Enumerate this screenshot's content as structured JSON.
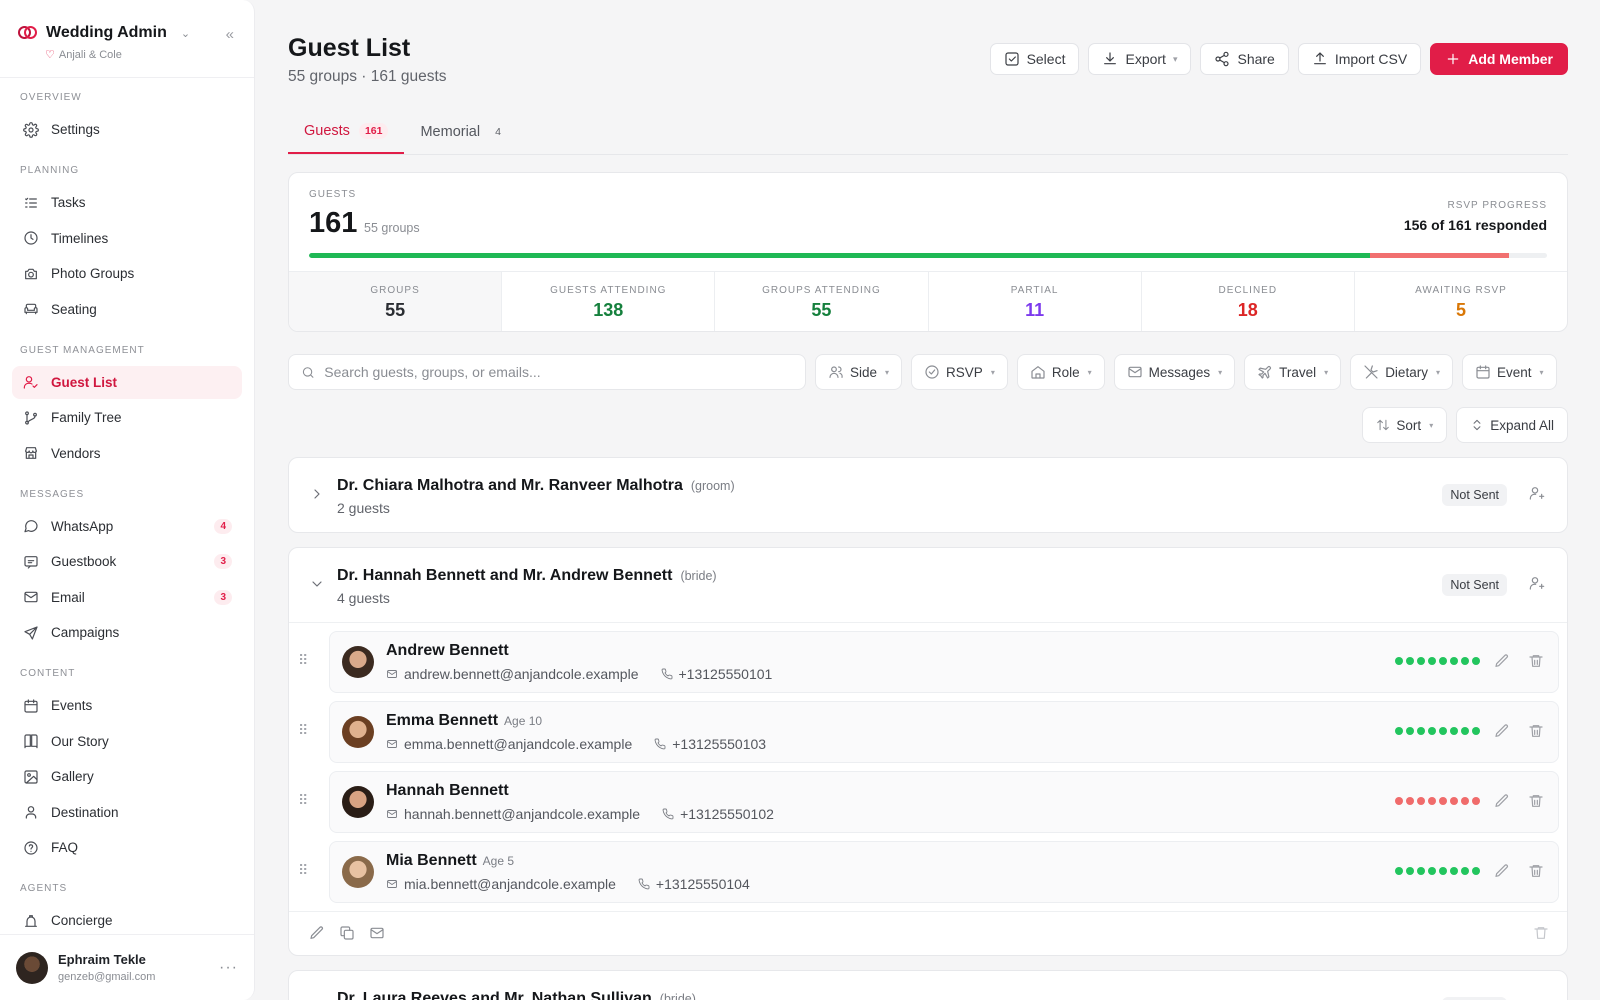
{
  "app": {
    "title": "Wedding Admin",
    "subtitle": "Anjali & Cole"
  },
  "sidebar": {
    "sections": [
      {
        "title": "OVERVIEW",
        "items": [
          {
            "label": "Settings",
            "icon": "gear-icon"
          }
        ]
      },
      {
        "title": "PLANNING",
        "items": [
          {
            "label": "Tasks",
            "icon": "list-icon"
          },
          {
            "label": "Timelines",
            "icon": "clock-icon"
          },
          {
            "label": "Photo Groups",
            "icon": "camera-icon"
          },
          {
            "label": "Seating",
            "icon": "sofa-icon"
          }
        ]
      },
      {
        "title": "GUEST MANAGEMENT",
        "items": [
          {
            "label": "Guest List",
            "icon": "user-check-icon",
            "active": true
          },
          {
            "label": "Family Tree",
            "icon": "branch-icon"
          },
          {
            "label": "Vendors",
            "icon": "store-icon"
          }
        ]
      },
      {
        "title": "MESSAGES",
        "items": [
          {
            "label": "WhatsApp",
            "icon": "chat-icon",
            "badge": "4"
          },
          {
            "label": "Guestbook",
            "icon": "message-square-icon",
            "badge": "3"
          },
          {
            "label": "Email",
            "icon": "mail-icon",
            "badge": "3"
          },
          {
            "label": "Campaigns",
            "icon": "send-icon"
          }
        ]
      },
      {
        "title": "CONTENT",
        "items": [
          {
            "label": "Events",
            "icon": "calendar-icon"
          },
          {
            "label": "Our Story",
            "icon": "book-icon"
          },
          {
            "label": "Gallery",
            "icon": "image-icon"
          },
          {
            "label": "Destination",
            "icon": "map-pin-icon"
          },
          {
            "label": "FAQ",
            "icon": "help-circle-icon"
          }
        ]
      },
      {
        "title": "AGENTS",
        "items": [
          {
            "label": "Concierge",
            "icon": "bell-icon"
          }
        ]
      }
    ]
  },
  "user": {
    "name": "Ephraim Tekle",
    "email": "genzeb@gmail.com"
  },
  "page": {
    "title": "Guest List",
    "subtitle": "55 groups · 161 guests"
  },
  "toolbar": {
    "select": "Select",
    "export": "Export",
    "share": "Share",
    "import": "Import CSV",
    "add": "Add Member"
  },
  "tabs": [
    {
      "label": "Guests",
      "count": "161",
      "active": true
    },
    {
      "label": "Memorial",
      "count": "4",
      "active": false
    }
  ],
  "summary": {
    "guests_caption": "GUESTS",
    "guests_total": "161",
    "groups_text": "55 groups",
    "rsvp_caption": "RSVP PROGRESS",
    "rsvp_text": "156 of 161 responded",
    "attending_fraction": 0.857,
    "declined_fraction": 0.112,
    "stats": [
      {
        "label": "GROUPS",
        "value": "55",
        "color": "#2b2e33",
        "selected": true
      },
      {
        "label": "GUESTS ATTENDING",
        "value": "138",
        "color": "#15803d"
      },
      {
        "label": "GROUPS ATTENDING",
        "value": "55",
        "color": "#15803d"
      },
      {
        "label": "PARTIAL",
        "value": "11",
        "color": "#7c3aed"
      },
      {
        "label": "DECLINED",
        "value": "18",
        "color": "#dc2626"
      },
      {
        "label": "AWAITING RSVP",
        "value": "5",
        "color": "#d97706"
      }
    ]
  },
  "filters": {
    "search_placeholder": "Search guests, groups, or emails...",
    "items": [
      {
        "label": "Side",
        "icon": "users-icon"
      },
      {
        "label": "RSVP",
        "icon": "check-circle-icon"
      },
      {
        "label": "Role",
        "icon": "home-icon"
      },
      {
        "label": "Messages",
        "icon": "mail-icon"
      },
      {
        "label": "Travel",
        "icon": "plane-icon"
      },
      {
        "label": "Dietary",
        "icon": "utensils-icon"
      },
      {
        "label": "Event",
        "icon": "calendar-icon"
      }
    ],
    "sort": "Sort",
    "expand": "Expand All"
  },
  "groups": [
    {
      "name": "Dr. Chiara Malhotra and Mr. Ranveer Malhotra",
      "side": "(groom)",
      "count": "2 guests",
      "status": "Not Sent",
      "expanded": false,
      "members": []
    },
    {
      "name": "Dr. Hannah Bennett and Mr. Andrew Bennett",
      "side": "(bride)",
      "count": "4 guests",
      "status": "Not Sent",
      "expanded": true,
      "members": [
        {
          "name": "Andrew Bennett",
          "age": "",
          "email": "andrew.bennett@anjandcole.example",
          "phone": "+13125550101",
          "dot_color": "#22c55e",
          "avatar": [
            "#3b2a20",
            "#d9a98a"
          ]
        },
        {
          "name": "Emma Bennett",
          "age": "Age 10",
          "email": "emma.bennett@anjandcole.example",
          "phone": "+13125550103",
          "dot_color": "#22c55e",
          "avatar": [
            "#6b3f22",
            "#e0b18e"
          ]
        },
        {
          "name": "Hannah Bennett",
          "age": "",
          "email": "hannah.bennett@anjandcole.example",
          "phone": "+13125550102",
          "dot_color": "#f06b6b",
          "avatar": [
            "#2a1d16",
            "#d8a282"
          ]
        },
        {
          "name": "Mia Bennett",
          "age": "Age 5",
          "email": "mia.bennett@anjandcole.example",
          "phone": "+13125550104",
          "dot_color": "#22c55e",
          "avatar": [
            "#8a6a4a",
            "#e8c2a2"
          ]
        }
      ]
    },
    {
      "name": "Dr. Laura Reeves and Mr. Nathan Sullivan",
      "side": "(bride)",
      "count": "",
      "status": "Not Sent",
      "expanded": false,
      "members": []
    }
  ]
}
